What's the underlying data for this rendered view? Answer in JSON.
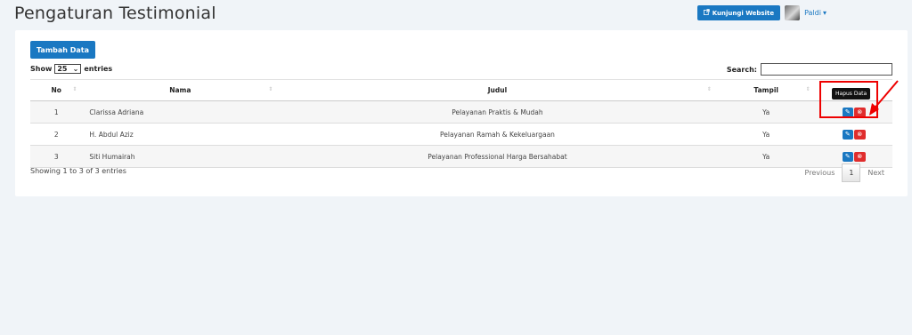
{
  "page": {
    "title": "Pengaturan Testimonial"
  },
  "header": {
    "visit_label": "Kunjungi Website",
    "user_name": "Paldi"
  },
  "card": {
    "add_button": "Tambah Data",
    "length": {
      "show": "Show",
      "value": "25",
      "entries": "entries"
    },
    "search_label": "Search:",
    "columns": [
      "No",
      "Nama",
      "Judul",
      "Tampil"
    ],
    "rows": [
      {
        "no": "1",
        "nama": "Clarissa Adriana",
        "judul": "Pelayanan Praktis & Mudah",
        "tampil": "Ya"
      },
      {
        "no": "2",
        "nama": "H. Abdul Aziz",
        "judul": "Pelayanan Ramah & Kekeluargaan",
        "tampil": "Ya"
      },
      {
        "no": "3",
        "nama": "Siti Humairah",
        "judul": "Pelayanan Professional Harga Bersahabat",
        "tampil": "Ya"
      }
    ],
    "info": "Showing 1 to 3 of 3 entries",
    "pager": {
      "prev": "Previous",
      "page": "1",
      "next": "Next"
    }
  },
  "tooltip": "Hapus Data",
  "colors": {
    "primary": "#1a78c2",
    "danger": "#e02d2d",
    "annotation": "#ee0000"
  }
}
